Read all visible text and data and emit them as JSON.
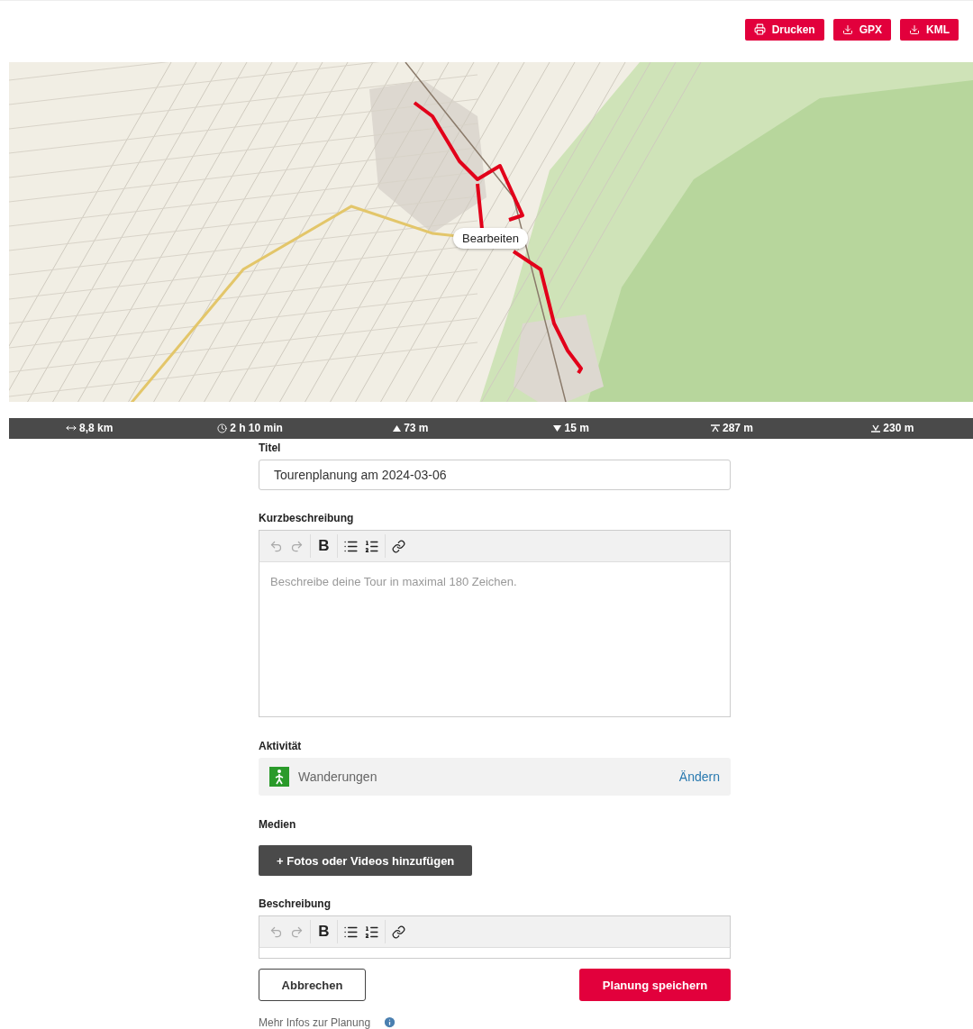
{
  "header_actions": [
    {
      "kind": "print",
      "label": "Drucken"
    },
    {
      "kind": "download",
      "label": "GPX"
    },
    {
      "kind": "download",
      "label": "KML"
    }
  ],
  "map": {
    "edit_label": "Bearbeiten"
  },
  "stats": [
    {
      "kind": "distance",
      "value": "8,8 km"
    },
    {
      "kind": "duration",
      "value": "2 h 10 min"
    },
    {
      "kind": "ascent",
      "value": "73 m"
    },
    {
      "kind": "descent",
      "value": "15 m"
    },
    {
      "kind": "max_altitude",
      "value": "287 m"
    },
    {
      "kind": "min_altitude",
      "value": "230 m"
    }
  ],
  "form": {
    "title": {
      "label": "Titel",
      "value": "Tourenplanung am 2024-03-06"
    },
    "short_description": {
      "label": "Kurzbeschreibung",
      "placeholder": "Beschreibe deine Tour in maximal 180 Zeichen.",
      "toolbar": [
        [
          {
            "kind": "undo",
            "disabled": true
          },
          {
            "kind": "redo",
            "disabled": true
          }
        ],
        [
          {
            "kind": "bold",
            "label": "B",
            "disabled": false
          }
        ],
        [
          {
            "kind": "bullet_list",
            "disabled": false
          },
          {
            "kind": "ordered_list",
            "disabled": false
          }
        ],
        [
          {
            "kind": "link",
            "disabled": false
          }
        ]
      ]
    },
    "activity": {
      "label": "Aktivität",
      "value": "Wanderungen",
      "action": "Ändern"
    },
    "media": {
      "label": "Medien",
      "button": "+ Fotos oder Videos hinzufügen"
    },
    "description": {
      "label": "Beschreibung",
      "toolbar": [
        [
          {
            "kind": "undo",
            "disabled": true
          },
          {
            "kind": "redo",
            "disabled": true
          }
        ],
        [
          {
            "kind": "bold",
            "label": "B",
            "disabled": false
          }
        ],
        [
          {
            "kind": "bullet_list",
            "disabled": false
          },
          {
            "kind": "ordered_list",
            "disabled": false
          }
        ],
        [
          {
            "kind": "link",
            "disabled": false
          }
        ]
      ]
    },
    "cancel": "Abbrechen",
    "save": "Planung speichern",
    "info_link": "Mehr Infos zur Planung"
  }
}
